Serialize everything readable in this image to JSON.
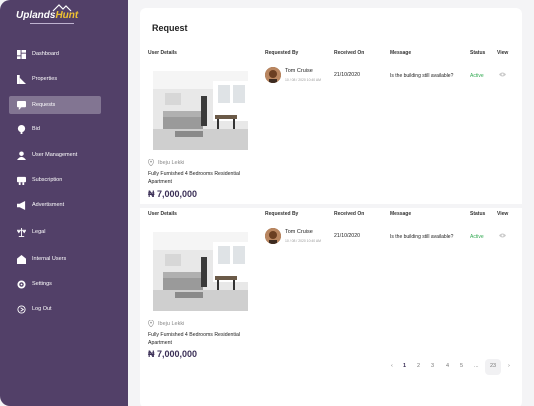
{
  "app": {
    "brand_part1": "Uplands",
    "brand_part2": "Hunt"
  },
  "sidebar": {
    "items": [
      {
        "label": "Dashboard",
        "icon": "dashboard-icon",
        "active": false
      },
      {
        "label": "Properties",
        "icon": "properties-icon",
        "active": false
      },
      {
        "label": "Requests",
        "icon": "requests-icon",
        "active": true
      },
      {
        "label": "Bid",
        "icon": "bid-icon",
        "active": false
      },
      {
        "label": "User Management",
        "icon": "user-icon",
        "active": false
      },
      {
        "label": "Subscription",
        "icon": "subscription-icon",
        "active": false
      },
      {
        "label": "Advertisment",
        "icon": "megaphone-icon",
        "active": false
      },
      {
        "label": "Legal",
        "icon": "scales-icon",
        "active": false
      },
      {
        "label": "Internal Users",
        "icon": "users-icon",
        "active": false
      },
      {
        "label": "Settings",
        "icon": "gear-icon",
        "active": false
      },
      {
        "label": "Log Out",
        "icon": "logout-icon",
        "active": false
      }
    ]
  },
  "main": {
    "title": "Request",
    "columns": {
      "user_details": "User Details",
      "requested_by": "Requested By",
      "received_on": "Received On",
      "message": "Message",
      "status": "Status",
      "view": "View"
    },
    "rows": [
      {
        "location": "Ibeju Lekki",
        "property_title": "Fully Furnished 4 Bedrooms Residential Apartment",
        "price": "₦ 7,000,000",
        "requester_name": "Tom Cruise",
        "requester_date": "10 / 08 / 2020 10:40 AM",
        "received_on": "21/10/2020",
        "message": "Is the building still available?",
        "status": "Active"
      },
      {
        "location": "Ibeju Lekki",
        "property_title": "Fully Furnished 4 Bedrooms Residential Apartment",
        "price": "₦ 7,000,000",
        "requester_name": "Tom Cruise",
        "requester_date": "10 / 08 / 2020 10:40 AM",
        "received_on": "21/10/2020",
        "message": "Is the building still available?",
        "status": "Active"
      }
    ]
  },
  "pagination": {
    "prev": "‹",
    "pages": [
      "1",
      "2",
      "3",
      "4",
      "5",
      "...",
      "23"
    ],
    "next": "›",
    "current": "1"
  },
  "colors": {
    "sidebar": "#524068",
    "accent": "#3b2f57",
    "logo_highlight": "#f0c330",
    "status_active": "#2fa84f"
  }
}
